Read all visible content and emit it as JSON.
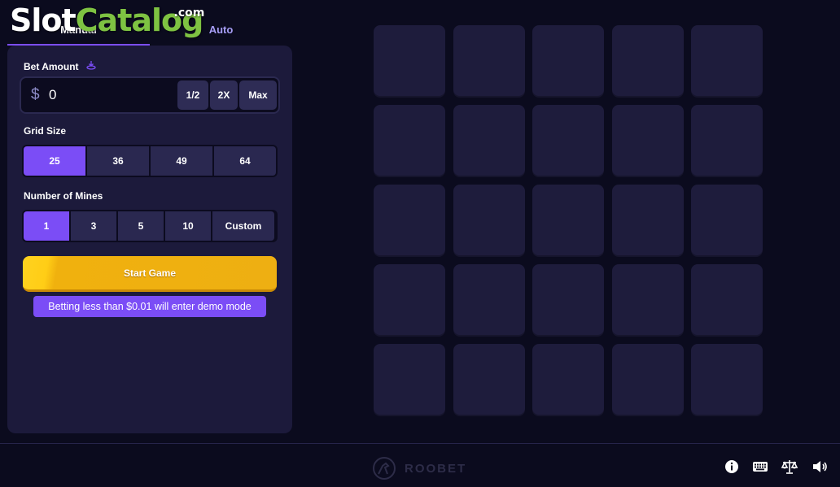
{
  "watermark": {
    "slot": "Slot",
    "catalog": "Catalog",
    "com": ".com"
  },
  "tabs": {
    "manual": "Manual",
    "auto": "Auto"
  },
  "bet": {
    "label": "Bet Amount",
    "currency": "$",
    "value": "0",
    "half_label": "1/2",
    "double_label": "2X",
    "max_label": "Max"
  },
  "grid_size": {
    "label": "Grid Size",
    "options": [
      "25",
      "36",
      "49",
      "64"
    ],
    "selected": "25"
  },
  "mines": {
    "label": "Number of Mines",
    "options": [
      "1",
      "3",
      "5",
      "10",
      "Custom"
    ],
    "selected": "1"
  },
  "start_button": "Start Game",
  "demo_note": "Betting less than $0.01 will enter demo mode",
  "board": {
    "rows": 5,
    "columns": 5
  },
  "footer": {
    "brand": "ROOBET",
    "icons": [
      "info-icon",
      "keyboard-icon",
      "balance-scale-icon",
      "volume-icon"
    ]
  },
  "colors": {
    "background": "#0b0b1e",
    "panel": "#1c1a3b",
    "accent": "#7b4df6",
    "start_button": "#f0b10e",
    "tile": "#1e1c3c"
  }
}
